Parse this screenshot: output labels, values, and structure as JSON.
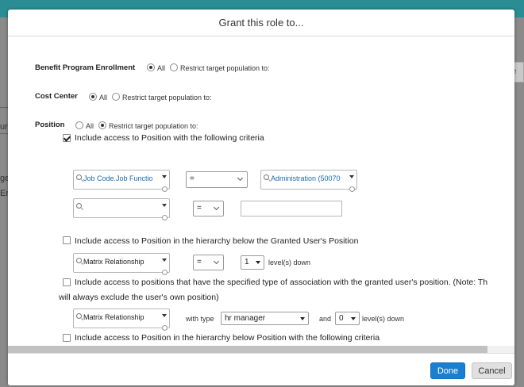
{
  "dialog": {
    "title": "Grant this role to...",
    "done_label": "Done",
    "cancel_label": "Cancel"
  },
  "background": {
    "side_tab": "e",
    "frag_1": "ur",
    "frag_2": "ge",
    "frag_3": "Er"
  },
  "benefit": {
    "label": "Benefit Program Enrollment",
    "all_label": "All",
    "restrict_label": "Restrict target population to:"
  },
  "cost_center": {
    "label": "Cost Center",
    "all_label": "All",
    "restrict_label": "Restrict target population to:"
  },
  "position": {
    "label": "Position",
    "all_label": "All",
    "restrict_label": "Restrict target population to:",
    "criteria_1": {
      "label": "Include access to Position with the following criteria",
      "row1_field": "Job Code.Job Functio",
      "row1_operator": "=",
      "row1_value": "Administration (50070",
      "row2_field": "",
      "row2_operator": "=",
      "row2_value": ""
    },
    "criteria_2": {
      "label": "Include access to Position in the hierarchy below the Granted User's Position",
      "field": "Matrix Relationship",
      "operator": "=",
      "levels": "1",
      "levels_suffix": "level(s) down"
    },
    "criteria_3": {
      "label_line1": "Include access to positions that have the specified type of association with the granted user's position. (Note: Th",
      "label_line2": "will always exclude the user's own position)",
      "field": "Matrix Relationship",
      "with_type_label": "with type",
      "type_value": "hr manager",
      "and_label": "and",
      "levels": "0",
      "levels_suffix": "level(s) down"
    },
    "criteria_4": {
      "label": "Include access to Position in the hierarchy below Position with the following criteria"
    }
  }
}
